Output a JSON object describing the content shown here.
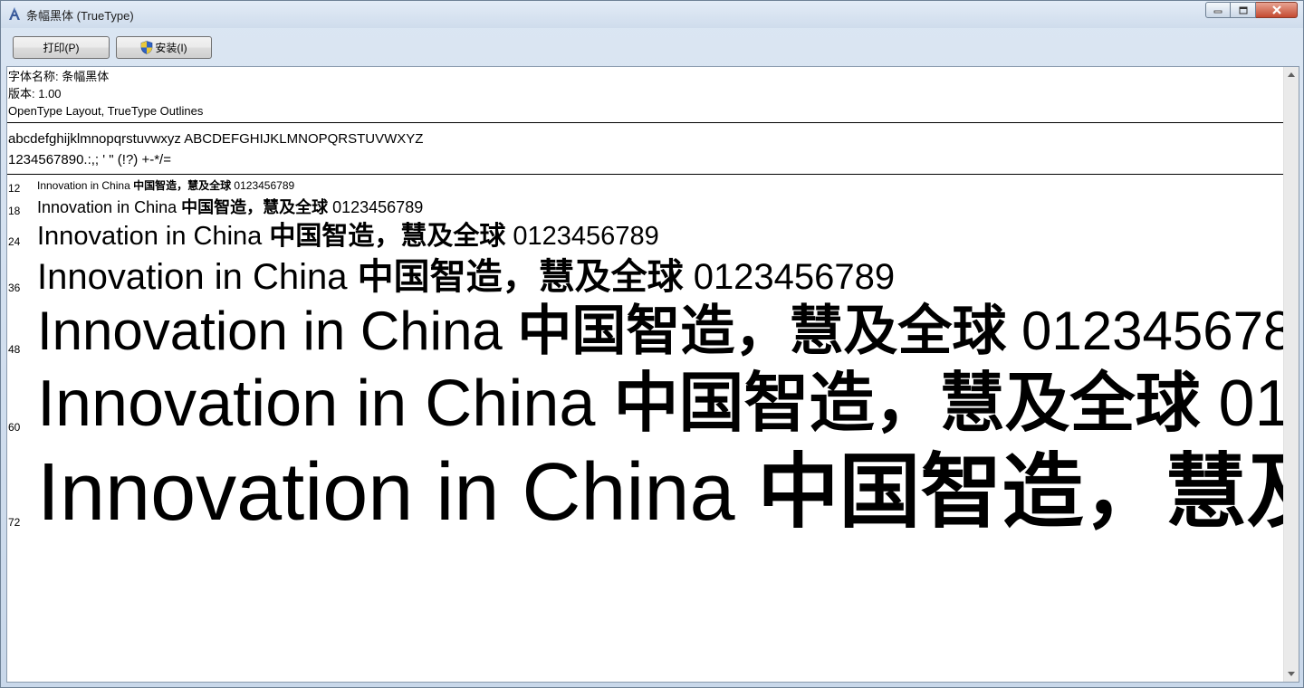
{
  "window": {
    "title": "条幅黑体 (TrueType)",
    "accent_close": "#c44a30"
  },
  "toolbar": {
    "print_label": "打印(P)",
    "install_label": "安装(I)"
  },
  "font_info": {
    "name_line": "字体名称: 条幅黑体",
    "version_line": "版本: 1.00",
    "outline_line": "OpenType Layout, TrueType Outlines"
  },
  "charset": {
    "letters_line": "abcdefghijklmnopqrstuvwxyz ABCDEFGHIJKLMNOPQRSTUVWXYZ",
    "digits_line": "1234567890.:,; ' \" (!?) +-*/="
  },
  "samples": {
    "latin": "Innovation in China ",
    "cjk": "中国智造，慧及全球",
    "digits": " 0123456789",
    "rows": [
      {
        "size": "12"
      },
      {
        "size": "18"
      },
      {
        "size": "24"
      },
      {
        "size": "36"
      },
      {
        "size": "48"
      },
      {
        "size": "60"
      },
      {
        "size": "72"
      }
    ]
  }
}
